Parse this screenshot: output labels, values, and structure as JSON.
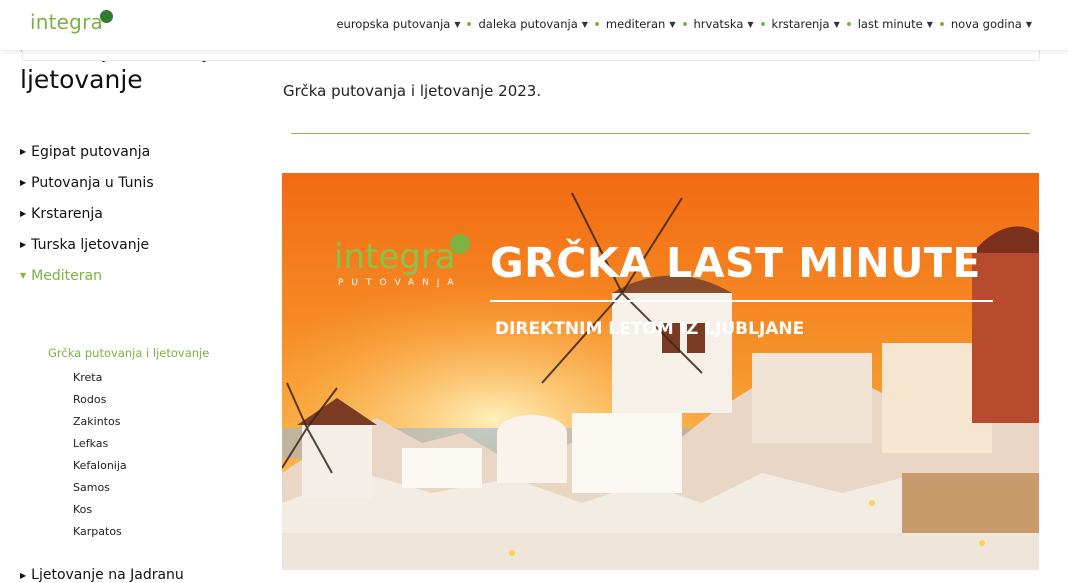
{
  "header": {
    "logo_text": "integra",
    "nav": [
      {
        "label": "europska putovanja"
      },
      {
        "label": "daleka putovanja"
      },
      {
        "label": "mediteran"
      },
      {
        "label": "hrvatska"
      },
      {
        "label": "krstarenja"
      },
      {
        "label": "last minute"
      },
      {
        "label": "nova godina"
      }
    ]
  },
  "sidebar": {
    "title": "Grčka putovanja i ljetovanje",
    "items": [
      {
        "label": "Egipat putovanja"
      },
      {
        "label": "Putovanja u Tunis"
      },
      {
        "label": "Krstarenja"
      },
      {
        "label": "Turska ljetovanje"
      },
      {
        "label": "Mediteran"
      }
    ],
    "active_sub": "Grčka putovanja i ljetovanje",
    "subsub": [
      "Kreta",
      "Rodos",
      "Zakintos",
      "Lefkas",
      "Kefalonija",
      "Samos",
      "Kos",
      "Karpatos"
    ],
    "last_item": "Ljetovanje na Jadranu"
  },
  "main": {
    "title": "Grčka putovanja i ljetovanje 2023.",
    "banner": {
      "logo": "integra",
      "logo_sub": "PUTOVANJA",
      "headline": "GRČKA LAST MINUTE",
      "subline": "DIREKTNIM LETOM IZ LJUBLJANE"
    }
  },
  "colors": {
    "accent": "#7cb342",
    "banner_sky_top": "#f57c00",
    "banner_sky_bottom": "#ffb74d"
  }
}
